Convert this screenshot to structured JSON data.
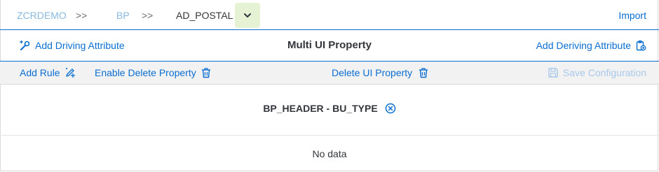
{
  "breadcrumb": {
    "items": [
      {
        "label": "ZCRDEMO"
      },
      {
        "label": "BP"
      },
      {
        "label": "AD_POSTAL"
      }
    ],
    "separator": ">>"
  },
  "header": {
    "import_label": "Import"
  },
  "titlebar": {
    "add_driving_label": "Add Driving Attribute",
    "title": "Multi UI Property",
    "add_deriving_label": "Add Deriving Attribute"
  },
  "actions": {
    "add_rule_label": "Add Rule",
    "enable_delete_label": "Enable Delete Property",
    "delete_ui_label": "Delete UI Property",
    "save_config_label": "Save Configuration"
  },
  "section": {
    "title": "BP_HEADER - BU_TYPE"
  },
  "table": {
    "empty_text": "No data"
  },
  "colors": {
    "accent": "#0a6ed1",
    "link_muted": "#89b9e0",
    "toggle_bg": "#e6f2d4",
    "toolbar_bg": "#f2f2f2"
  }
}
